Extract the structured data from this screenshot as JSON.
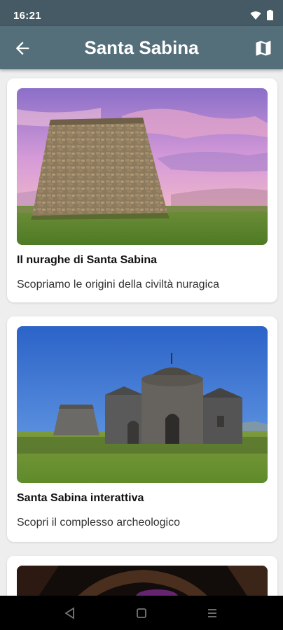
{
  "status_bar": {
    "time": "16:21",
    "icons": [
      "wifi-icon",
      "battery-icon"
    ]
  },
  "app_bar": {
    "title": "Santa Sabina",
    "back_icon": "arrow-back-icon",
    "map_icon": "map-icon"
  },
  "cards": [
    {
      "title": "Il nuraghe di Santa Sabina",
      "subtitle": "Scopriamo le origini della civiltà nuragica",
      "image": "nuraghe-tower-photo"
    },
    {
      "title": "Santa Sabina interattiva",
      "subtitle": "Scopri il complesso archeologico",
      "image": "church-and-nuraghe-photo"
    },
    {
      "title": "",
      "subtitle": "",
      "image": "dark-interior-photo"
    }
  ],
  "nav_bar": {
    "icons": [
      "back-triangle-icon",
      "home-square-icon",
      "recents-menu-icon"
    ]
  },
  "colors": {
    "status_bar": "#455a64",
    "app_bar": "#546e7a",
    "background": "#eeeeee",
    "card": "#ffffff"
  }
}
